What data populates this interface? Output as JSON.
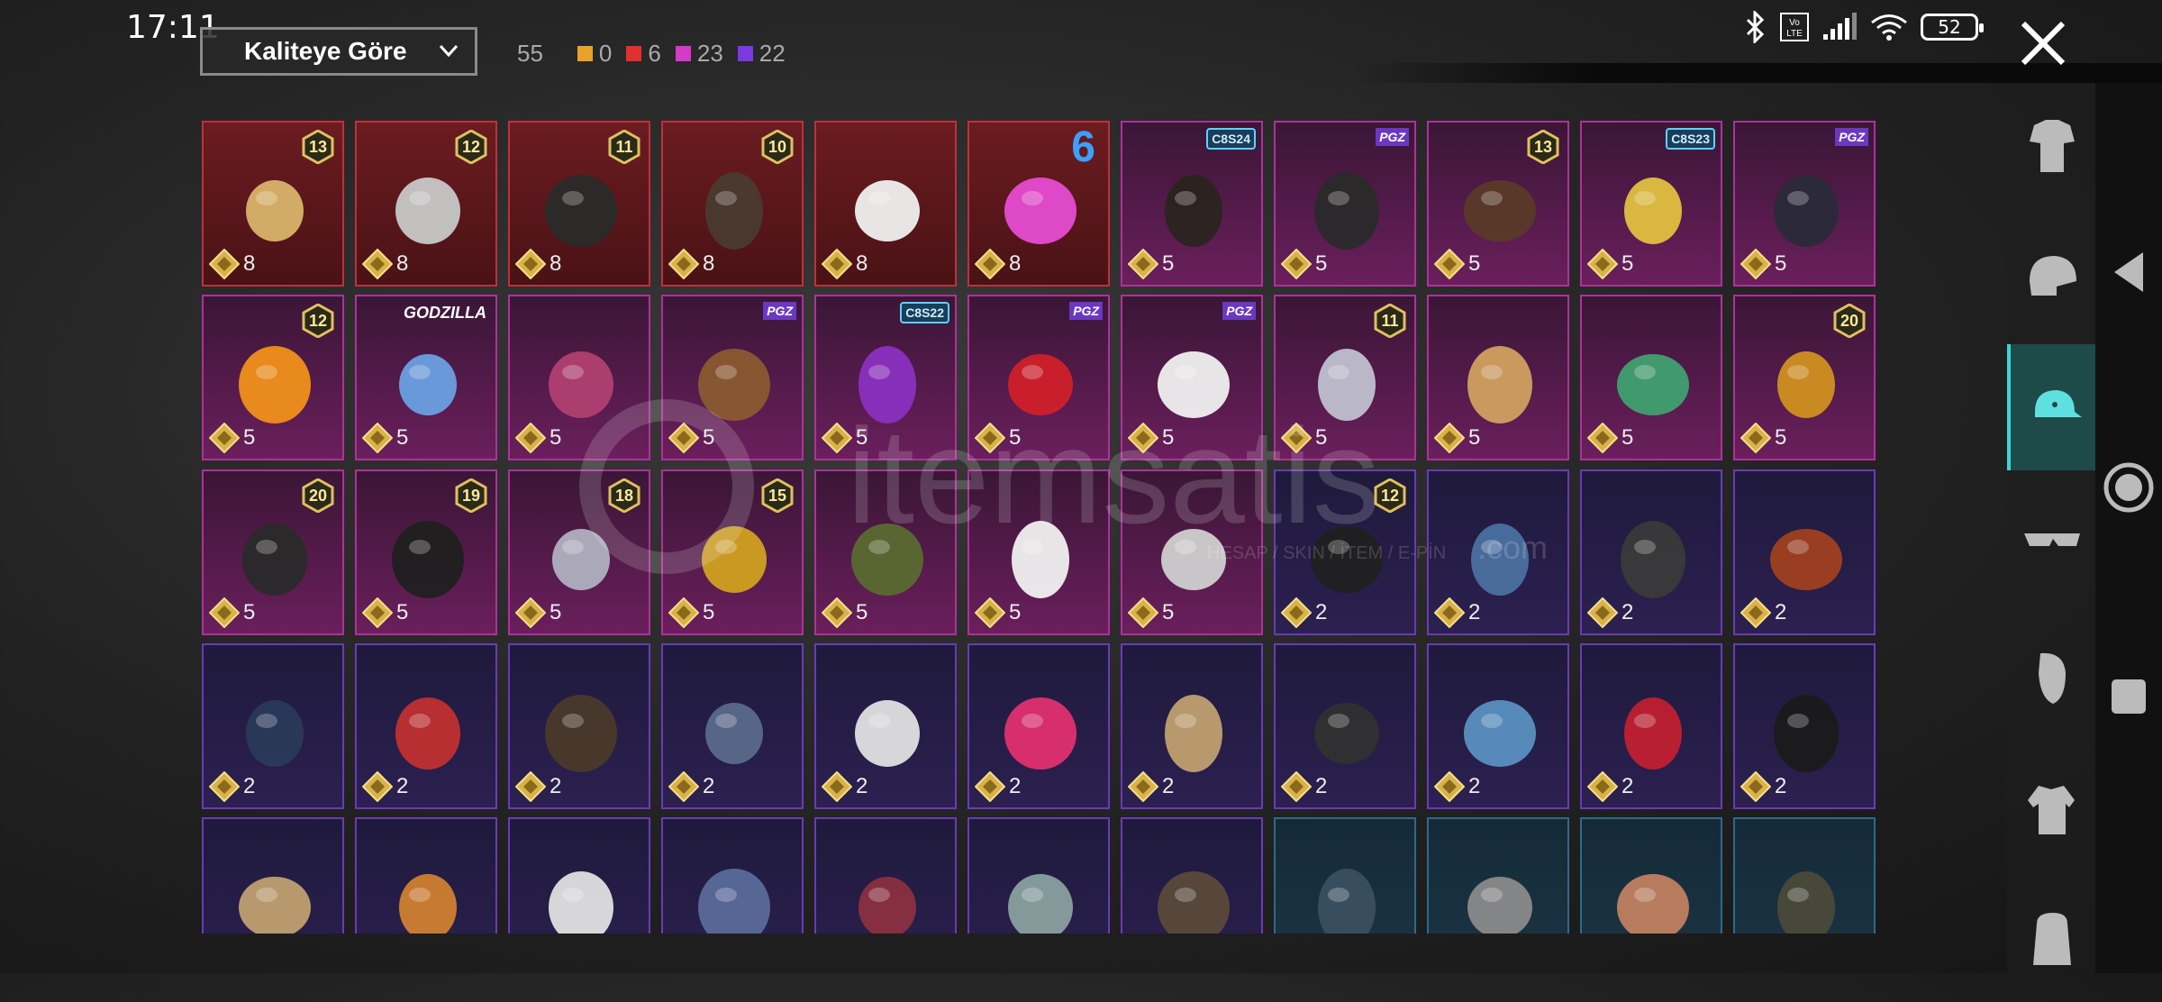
{
  "status_bar": {
    "time": "17:11",
    "battery": "52"
  },
  "toolbar": {
    "sort_label": "Kaliteye Göre",
    "total": "55",
    "rarity_counts": [
      {
        "color": "#e8a12a",
        "count": "0"
      },
      {
        "color": "#e03030",
        "count": "6"
      },
      {
        "color": "#d63ac8",
        "count": "23"
      },
      {
        "color": "#7a3ae0",
        "count": "22"
      }
    ]
  },
  "items": [
    {
      "rarity": "red",
      "points": "8",
      "badge": "13",
      "icon": "feathered-hat-icon"
    },
    {
      "rarity": "red",
      "points": "8",
      "badge": "12",
      "icon": "white-hair-icon"
    },
    {
      "rarity": "red",
      "points": "8",
      "badge": "11",
      "icon": "dark-hair-icon"
    },
    {
      "rarity": "red",
      "points": "8",
      "badge": "10",
      "icon": "braided-hair-icon"
    },
    {
      "rarity": "red",
      "points": "8",
      "badge": "",
      "icon": "cowboy-hat-icon"
    },
    {
      "rarity": "red",
      "points": "8",
      "tag": "6",
      "tag_style": "big6",
      "icon": "pink-box-head-icon"
    },
    {
      "rarity": "pink",
      "points": "5",
      "tag": "C8S24",
      "tag_style": "cbs",
      "icon": "bob-hair-icon"
    },
    {
      "rarity": "pink",
      "points": "5",
      "tag": "PGZ",
      "tag_style": "pgz",
      "icon": "dark-hair-ribbon-icon"
    },
    {
      "rarity": "pink",
      "points": "5",
      "badge": "13",
      "icon": "goggles-hair-icon"
    },
    {
      "rarity": "pink",
      "points": "5",
      "tag": "C8S23",
      "tag_style": "cbs",
      "icon": "cat-headphones-icon"
    },
    {
      "rarity": "pink",
      "points": "5",
      "tag": "PGZ",
      "tag_style": "pgz",
      "icon": "cap-glasses-icon"
    },
    {
      "rarity": "pink",
      "points": "5",
      "badge": "12",
      "icon": "orange-hair-icon"
    },
    {
      "rarity": "pink",
      "points": "5",
      "tag": "GODZILLA",
      "tag_style": "gz",
      "icon": "blue-hair-icon"
    },
    {
      "rarity": "pink",
      "points": "5",
      "badge": "",
      "icon": "pink-short-hair-icon"
    },
    {
      "rarity": "pink",
      "points": "5",
      "tag": "PGZ",
      "tag_style": "pgz",
      "icon": "bear-mask-icon"
    },
    {
      "rarity": "pink",
      "points": "5",
      "tag": "C8S22",
      "tag_style": "cbs",
      "icon": "rainbow-hair-icon"
    },
    {
      "rarity": "pink",
      "points": "5",
      "tag": "PGZ",
      "tag_style": "pgz",
      "icon": "red-hair-icon"
    },
    {
      "rarity": "pink",
      "points": "5",
      "tag": "PGZ",
      "tag_style": "pgz",
      "icon": "panda-mask-icon"
    },
    {
      "rarity": "pink",
      "points": "5",
      "badge": "11",
      "icon": "flower-veil-icon"
    },
    {
      "rarity": "pink",
      "points": "5",
      "badge": "",
      "icon": "blonde-hair-icon"
    },
    {
      "rarity": "pink",
      "points": "5",
      "badge": "",
      "icon": "feather-headdress-icon"
    },
    {
      "rarity": "pink",
      "points": "5",
      "badge": "20",
      "icon": "monkey-king-helmet-icon"
    },
    {
      "rarity": "pink",
      "points": "5",
      "badge": "20",
      "icon": "black-gold-mask-icon"
    },
    {
      "rarity": "pink",
      "points": "5",
      "badge": "19",
      "icon": "black-bun-hair-icon"
    },
    {
      "rarity": "pink",
      "points": "5",
      "badge": "18",
      "icon": "silver-crown-hair-icon"
    },
    {
      "rarity": "pink",
      "points": "5",
      "badge": "15",
      "icon": "gold-helmet-icon"
    },
    {
      "rarity": "pink",
      "points": "5",
      "badge": "",
      "icon": "green-helmet-icon"
    },
    {
      "rarity": "pink",
      "points": "5",
      "badge": "",
      "icon": "white-bucket-hat-icon"
    },
    {
      "rarity": "pink",
      "points": "5",
      "badge": "",
      "icon": "chicken-mask-icon"
    },
    {
      "rarity": "purple",
      "points": "2",
      "badge": "12",
      "icon": "bunny-helmet-icon"
    },
    {
      "rarity": "purple",
      "points": "2",
      "badge": "",
      "icon": "blue-cap-icon"
    },
    {
      "rarity": "purple",
      "points": "2",
      "badge": "",
      "icon": "visor-helmet-icon"
    },
    {
      "rarity": "purple",
      "points": "2",
      "badge": "",
      "icon": "goggles-red-hair-icon"
    },
    {
      "rarity": "purple",
      "points": "2",
      "badge": "",
      "icon": "beanie-icon"
    },
    {
      "rarity": "purple",
      "points": "2",
      "badge": "",
      "icon": "football-helmet-icon"
    },
    {
      "rarity": "purple",
      "points": "2",
      "badge": "",
      "icon": "long-hair-icon"
    },
    {
      "rarity": "purple",
      "points": "2",
      "badge": "",
      "icon": "grey-cap-icon"
    },
    {
      "rarity": "purple",
      "points": "2",
      "badge": "",
      "icon": "bandana-icon"
    },
    {
      "rarity": "purple",
      "points": "2",
      "badge": "",
      "icon": "pink-cap-icon"
    },
    {
      "rarity": "purple",
      "points": "2",
      "badge": "",
      "icon": "scarecrow-hat-icon"
    },
    {
      "rarity": "purple",
      "points": "2",
      "badge": "",
      "icon": "wrestler-mask-icon"
    },
    {
      "rarity": "purple",
      "points": "2",
      "badge": "",
      "icon": "shark-hat-icon"
    },
    {
      "rarity": "purple",
      "points": "2",
      "badge": "",
      "icon": "red-beret-icon"
    },
    {
      "rarity": "purple",
      "points": "2",
      "badge": "",
      "icon": "top-hat-icon"
    },
    {
      "rarity": "purple",
      "points": "",
      "badge": "",
      "icon": "cupcake-hat-icon"
    },
    {
      "rarity": "purple",
      "points": "",
      "badge": "",
      "icon": "burger-hat-icon"
    },
    {
      "rarity": "purple",
      "points": "",
      "badge": "",
      "icon": "head-mirror-icon"
    },
    {
      "rarity": "purple",
      "points": "",
      "badge": "",
      "icon": "garrison-cap-icon"
    },
    {
      "rarity": "purple",
      "points": "",
      "badge": "",
      "icon": "fedora-icon"
    },
    {
      "rarity": "purple",
      "points": "",
      "badge": "",
      "icon": "checkered-helmet-icon"
    },
    {
      "rarity": "purple",
      "points": "",
      "badge": "",
      "icon": "aviator-cap-icon"
    },
    {
      "rarity": "blue",
      "points": "",
      "badge": "",
      "icon": "beret-icon"
    },
    {
      "rarity": "blue",
      "points": "",
      "badge": "",
      "icon": "flat-cap-icon"
    },
    {
      "rarity": "blue",
      "points": "",
      "badge": "",
      "icon": "trucker-cap-icon"
    },
    {
      "rarity": "blue",
      "points": "",
      "badge": "",
      "icon": "camo-cap-icon"
    }
  ],
  "sidebar_categories": [
    {
      "icon": "outfit-icon"
    },
    {
      "icon": "helmet-icon"
    },
    {
      "icon": "cap-icon",
      "selected": true
    },
    {
      "icon": "glasses-icon"
    },
    {
      "icon": "mask-icon"
    },
    {
      "icon": "jacket-icon"
    },
    {
      "icon": "backpack-icon"
    }
  ],
  "watermark": {
    "brand": "itemsatis",
    "subtitle": "HESAP / SKIN / İTEM / E-PİN",
    "tld": ".com"
  }
}
